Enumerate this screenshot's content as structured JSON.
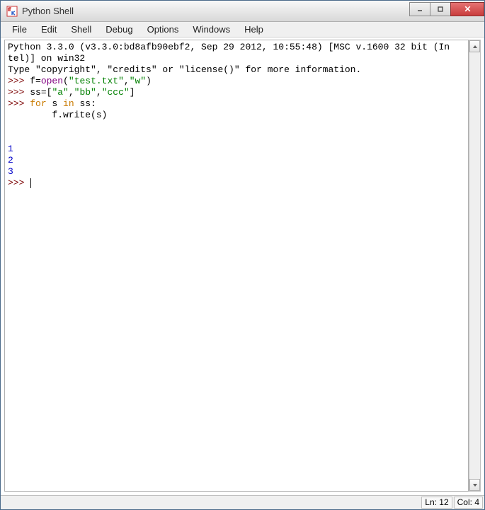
{
  "window": {
    "title": "Python Shell"
  },
  "menu": {
    "items": [
      "File",
      "Edit",
      "Shell",
      "Debug",
      "Options",
      "Windows",
      "Help"
    ]
  },
  "shell": {
    "banner1": "Python 3.3.0 (v3.3.0:bd8afb90ebf2, Sep 29 2012, 10:55:48) [MSC v.1600 32 bit (In",
    "banner2": "tel)] on win32",
    "banner3": "Type \"copyright\", \"credits\" or \"license()\" for more information.",
    "p1_prompt": ">>> ",
    "p1_a": "f=",
    "p1_b": "open",
    "p1_c": "(",
    "p1_d": "\"test.txt\"",
    "p1_e": ",",
    "p1_f": "\"w\"",
    "p1_g": ")",
    "p2_prompt": ">>> ",
    "p2_a": "ss=[",
    "p2_b": "\"a\"",
    "p2_c": ",",
    "p2_d": "\"bb\"",
    "p2_e": ",",
    "p2_f": "\"ccc\"",
    "p2_g": "]",
    "p3_prompt": ">>> ",
    "p3_a": "for",
    "p3_b": " s ",
    "p3_c": "in",
    "p3_d": " ss:",
    "p4_indent": "        ",
    "p4_body": "f.write(s)",
    "blank1": "",
    "blank2": " ",
    "out1": "1",
    "out2": "2",
    "out3": "3",
    "p5_prompt": ">>> "
  },
  "status": {
    "ln": "Ln: 12",
    "col": "Col: 4"
  }
}
